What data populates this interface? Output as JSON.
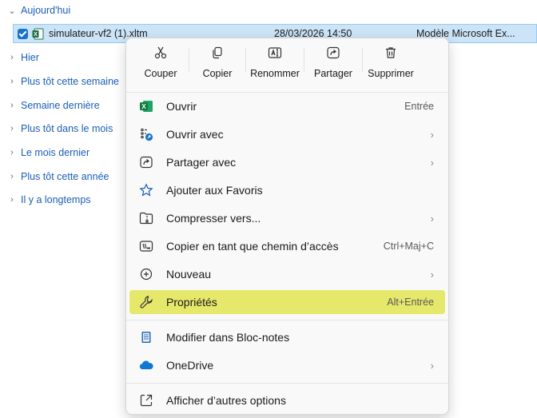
{
  "groups": {
    "today": "Aujourd'hui",
    "yesterday": "Hier",
    "earlier_this_week": "Plus tôt cette semaine",
    "last_week": "Semaine dernière",
    "earlier_this_month": "Plus tôt dans le mois",
    "last_month": "Le mois dernier",
    "earlier_this_year": "Plus tôt cette année",
    "long_ago": "Il y a longtemps"
  },
  "file": {
    "name": "simulateur-vf2 (1).xltm",
    "date": "28/03/2026 14:50",
    "type": "Modèle Microsoft Ex..."
  },
  "context_menu": {
    "quick_actions": {
      "cut": "Couper",
      "copy": "Copier",
      "rename": "Renommer",
      "share": "Partager",
      "delete": "Supprimer"
    },
    "items": {
      "open": {
        "label": "Ouvrir",
        "shortcut": "Entrée"
      },
      "open_with": {
        "label": "Ouvrir avec"
      },
      "share_with": {
        "label": "Partager avec"
      },
      "add_favorites": {
        "label": "Ajouter aux Favoris"
      },
      "compress": {
        "label": "Compresser vers..."
      },
      "copy_path": {
        "label": "Copier en tant que chemin d’accès",
        "shortcut": "Ctrl+Maj+C"
      },
      "new": {
        "label": "Nouveau"
      },
      "properties": {
        "label": "Propriétés",
        "shortcut": "Alt+Entrée"
      },
      "edit_notepad": {
        "label": "Modifier dans Bloc-notes"
      },
      "onedrive": {
        "label": "OneDrive"
      },
      "more_options": {
        "label": "Afficher d’autres options"
      }
    },
    "submenu_arrow": "›",
    "highlight_color": "#e5e86a"
  },
  "icons": {
    "chevron_down": "⌄",
    "chevron_right": "›"
  }
}
